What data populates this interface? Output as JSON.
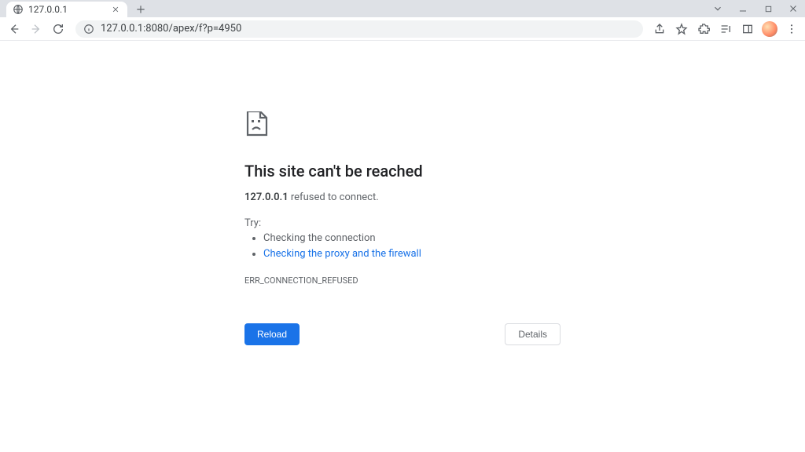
{
  "tab": {
    "title": "127.0.0.1"
  },
  "address_bar": {
    "url": "127.0.0.1:8080/apex/f?p=4950"
  },
  "error": {
    "heading": "This site can't be reached",
    "host": "127.0.0.1",
    "message_suffix": " refused to connect.",
    "try_label": "Try:",
    "suggestions": {
      "s0": "Checking the connection",
      "s1": "Checking the proxy and the firewall"
    },
    "error_code": "ERR_CONNECTION_REFUSED",
    "reload_label": "Reload",
    "details_label": "Details"
  }
}
